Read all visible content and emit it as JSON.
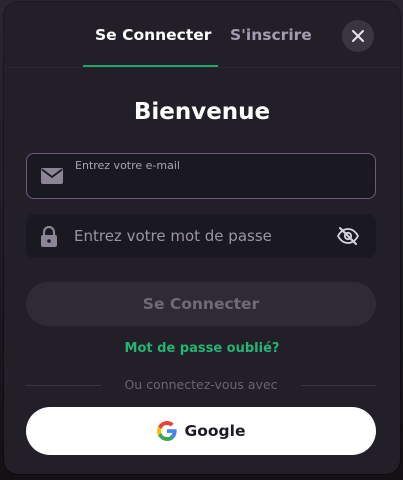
{
  "tabs": {
    "login_label": "Se Connecter",
    "signup_label": "S'inscrire",
    "active": "login"
  },
  "close_icon": "close-icon",
  "title": "Bienvenue",
  "email": {
    "label": "Entrez votre e-mail",
    "value": "",
    "icon": "mail-icon"
  },
  "password": {
    "placeholder": "Entrez votre mot de passe",
    "icon": "lock-icon",
    "toggle_icon": "eye-off-icon"
  },
  "submit_label": "Se Connecter",
  "forgot_label": "Mot de passe oublié?",
  "divider_label": "Ou connectez-vous avec",
  "google": {
    "label": "Google",
    "icon": "google-icon"
  },
  "colors": {
    "accent": "#22b573",
    "modal_bg": "#221f28",
    "field_bg": "#1a1820",
    "focus_border": "#6a5a7e",
    "disabled_button_bg": "#2f2b35"
  }
}
